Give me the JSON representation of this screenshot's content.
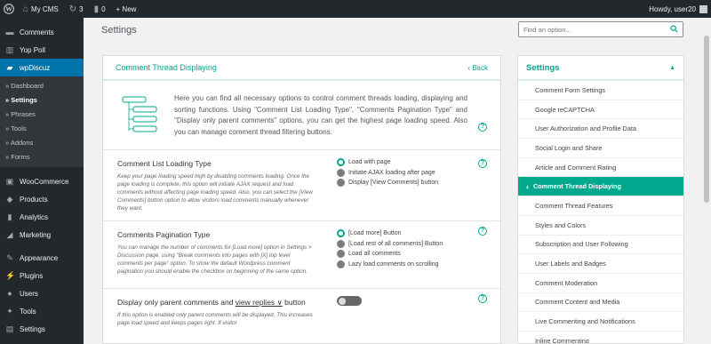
{
  "admin_bar": {
    "site_name": "My CMS",
    "updates_count": "3",
    "comments_count": "0",
    "new_label": "+ New",
    "howdy": "Howdy, user20"
  },
  "sidebar": {
    "top_items": [
      {
        "label": "Comments",
        "icon": "comment-icon"
      },
      {
        "label": "Yop Poll",
        "icon": "poll-icon"
      },
      {
        "label": "wpDiscuz",
        "icon": "wpdiscuz-icon"
      }
    ],
    "submenu": [
      "» Dashboard",
      "» Settings",
      "» Phrases",
      "» Tools",
      "» Addons",
      "» Forms"
    ],
    "bottom_items": [
      {
        "label": "WooCommerce",
        "icon": "woocommerce-icon"
      },
      {
        "label": "Products",
        "icon": "products-icon"
      },
      {
        "label": "Analytics",
        "icon": "analytics-icon"
      },
      {
        "label": "Marketing",
        "icon": "marketing-icon"
      },
      {
        "label": "Appearance",
        "icon": "appearance-icon"
      },
      {
        "label": "Plugins",
        "icon": "plugins-icon"
      },
      {
        "label": "Users",
        "icon": "users-icon"
      },
      {
        "label": "Tools",
        "icon": "tools-icon"
      },
      {
        "label": "Settings",
        "icon": "settings-icon"
      }
    ]
  },
  "page": {
    "title": "Settings",
    "search_placeholder": "Find an option..."
  },
  "panel": {
    "title": "Comment Thread Displaying",
    "back_label": "‹ Back",
    "intro": "Here you can find all necessary options to control comment threads loading, displaying and sorting functions. Using \"Comment List Loading Type\", \"Comments Pagination Type\" and \"Display only parent comments\" options, you can get the highest page loading speed. Also you can manage comment thread filtering buttons.",
    "options": [
      {
        "title": "Comment List Loading Type",
        "desc": "Keep your page loading speed high by disabling comments loading. Once the page loading is complete, this option will initiate AJAX request and load comments without affecting page loading speed. Also, you can select the [View Comments] button option to allow visitors load comments manually whenever they want.",
        "radios": [
          {
            "label": "Load with page",
            "checked": true
          },
          {
            "label": "Initiate AJAX loading after page",
            "checked": false
          },
          {
            "label": "Display [View Comments] button",
            "checked": false
          }
        ]
      },
      {
        "title": "Comments Pagination Type",
        "desc": "You can manage the number of comments for [Load more] option in Settings > Discussion page, using \"Break comments into pages with [X] top level comments per page\" option. To show the default Wordpress comment pagination you should enable the checkbox on beginning of the same option.",
        "radios": [
          {
            "label": "[Load more] Button",
            "checked": true
          },
          {
            "label": "[Load rest of all comments] Button",
            "checked": false
          },
          {
            "label": "Load all comments",
            "checked": false
          },
          {
            "label": "Lazy load comments on scrolling",
            "checked": false
          }
        ]
      },
      {
        "title_prefix": "Display only parent comments and ",
        "title_link": "view replies ∨",
        "title_suffix": " button",
        "desc": "If this option is enabled only parent comments will be displayed. This increases page load speed and keeps pages light. If visitor",
        "toggle_on": false
      }
    ]
  },
  "settings_nav": {
    "header": "Settings",
    "items": [
      "Comment Form Settings",
      "Google reCAPTCHA",
      "User Authorization and Profile Data",
      "Social Login and Share",
      "Article and Comment Rating",
      "Comment Thread Displaying",
      "Comment Thread Features",
      "Styles and Colors",
      "Subscription and User Following",
      "User Labels and Badges",
      "Comment Moderation",
      "Comment Content and Media",
      "Live Commenting and Notifications",
      "Inline Commenting"
    ],
    "active_index": 5
  },
  "colors": {
    "accent": "#00a88e",
    "wp_blue": "#0073aa",
    "sidebar_bg": "#23282d"
  }
}
